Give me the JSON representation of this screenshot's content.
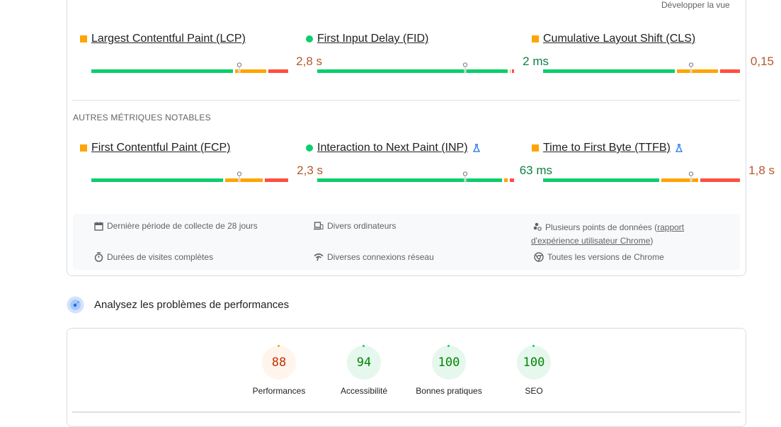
{
  "header": {
    "expand_label": "Développer la vue"
  },
  "core_metrics": [
    {
      "name": "Largest Contentful Paint (LCP)",
      "value": "2,8 s",
      "status": "average",
      "indicator": "square",
      "experimental": false,
      "distribution": {
        "good": 0.73,
        "average": 0.17,
        "poor": 0.1
      },
      "marker_position": 0.75
    },
    {
      "name": "First Input Delay (FID)",
      "value": "2 ms",
      "status": "good",
      "indicator": "circle",
      "experimental": false,
      "distribution": {
        "good": 0.98,
        "average": 0.01,
        "poor": 0.01
      },
      "marker_position": 0.75
    },
    {
      "name": "Cumulative Layout Shift (CLS)",
      "value": "0,15",
      "status": "average",
      "indicator": "square",
      "experimental": false,
      "distribution": {
        "good": 0.68,
        "average": 0.22,
        "poor": 0.1
      },
      "marker_position": 0.75
    }
  ],
  "other_section_label": "AUTRES MÉTRIQUES NOTABLES",
  "other_metrics": [
    {
      "name": "First Contentful Paint (FCP)",
      "value": "2,3 s",
      "status": "average",
      "indicator": "square",
      "experimental": false,
      "distribution": {
        "good": 0.68,
        "average": 0.2,
        "poor": 0.12
      },
      "marker_position": 0.75
    },
    {
      "name": "Interaction to Next Paint (INP)",
      "value": "63 ms",
      "status": "good",
      "indicator": "circle",
      "experimental": true,
      "distribution": {
        "good": 0.95,
        "average": 0.03,
        "poor": 0.02
      },
      "marker_position": 0.75
    },
    {
      "name": "Time to First Byte (TTFB)",
      "value": "1,8 s",
      "status": "average",
      "indicator": "square",
      "experimental": true,
      "distribution": {
        "good": 0.6,
        "average": 0.2,
        "poor": 0.2
      },
      "marker_position": 0.75
    }
  ],
  "info": {
    "period": "Dernière période de collecte de 28 jours",
    "devices": "Divers ordinateurs",
    "datapoints_prefix": "Plusieurs points de données (",
    "datapoints_link": "rapport d'expérience utilisateur Chrome",
    "datapoints_suffix": ")",
    "durations": "Durées de visites complètes",
    "network": "Diverses connexions réseau",
    "chrome": "Toutes les versions de Chrome"
  },
  "analyse": {
    "title": "Analysez les problèmes de performances"
  },
  "scores": [
    {
      "label": "Performances",
      "value": "88",
      "status": "average"
    },
    {
      "label": "Accessibilité",
      "value": "94",
      "status": "good"
    },
    {
      "label": "Bonnes pratiques",
      "value": "100",
      "status": "good"
    },
    {
      "label": "SEO",
      "value": "100",
      "status": "good"
    }
  ],
  "colors": {
    "good": "#0cce6b",
    "average": "#ffa400",
    "poor": "#ff4e42",
    "good_text": "#0d8043",
    "average_text": "#b3592d",
    "score_good_text": "#008800",
    "score_avg_text": "#c33300",
    "score_good_bg": "#e6f7ee",
    "score_avg_bg": "#fff5ec"
  }
}
